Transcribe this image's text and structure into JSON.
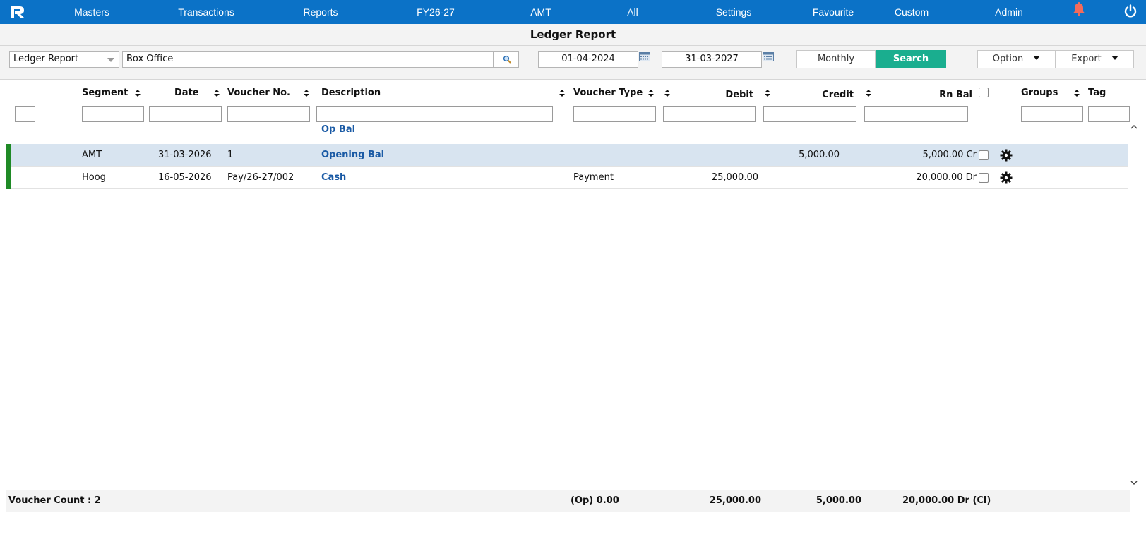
{
  "nav": {
    "items": [
      "Masters",
      "Transactions",
      "Reports",
      "FY26-27",
      "AMT",
      "All",
      "Settings",
      "Favourite",
      "Custom",
      "Admin"
    ]
  },
  "page": {
    "title": "Ledger Report"
  },
  "toolbar": {
    "report_type": "Ledger Report",
    "ledger_value": "Box Office",
    "from_date": "01-04-2024",
    "to_date": "31-03-2027",
    "monthly_label": "Monthly",
    "search_label": "Search",
    "option_label": "Option",
    "export_label": "Export"
  },
  "columns": {
    "segment": "Segment",
    "date": "Date",
    "voucher_no": "Voucher No.",
    "description": "Description",
    "voucher_type": "Voucher Type",
    "debit": "Debit",
    "credit": "Credit",
    "rn_bal": "Rn Bal",
    "groups": "Groups",
    "tag": "Tag"
  },
  "op_bal_label": "Op Bal",
  "rows": [
    {
      "segment": "AMT",
      "date": "31-03-2026",
      "voucher_no": "1",
      "description": "Opening Bal",
      "voucher_type": "",
      "debit": "",
      "credit": "5,000.00",
      "rn_bal": "5,000.00 Cr"
    },
    {
      "segment": "Hoog",
      "date": "16-05-2026",
      "voucher_no": "Pay/26-27/002",
      "description": "Cash",
      "voucher_type": "Payment",
      "debit": "25,000.00",
      "credit": "",
      "rn_bal": "20,000.00 Dr"
    }
  ],
  "footer": {
    "voucher_count": "Voucher Count : 2",
    "op_total": "(Op) 0.00",
    "debit_total": "25,000.00",
    "credit_total": "5,000.00",
    "closing": "20,000.00 Dr (Cl)"
  },
  "colors": {
    "nav_bg": "#0b72c7",
    "search_btn": "#1aae8f",
    "row_indicator": "#1f8a26",
    "highlight_row": "#d8e4f0",
    "link": "#1a5aa5",
    "bell": "#f26b5b"
  }
}
